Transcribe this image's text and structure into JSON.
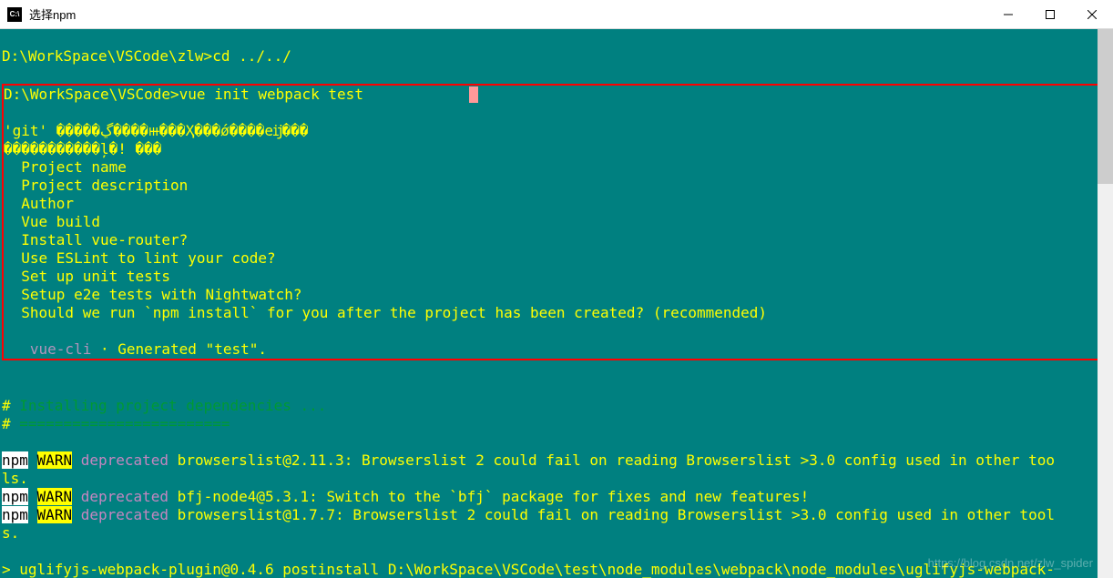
{
  "window": {
    "title": "选择npm",
    "icon_label": "C:\\"
  },
  "terminal": {
    "prompt1": "D:\\WorkSpace\\VSCode\\zlw>",
    "cmd1": "cd ../../",
    "prompt2": "D:\\WorkSpace\\VSCode>",
    "cmd2": "vue init webpack test",
    "git_line1": "'git' �����ڲ����ⲿ���Ҳ���ǿ����еĳ���",
    "git_line2": "�����������ļ�! ���",
    "prompts": [
      "Project name",
      "Project description",
      "Author",
      "Vue build",
      "Install vue-router?",
      "Use ESLint to lint your code?",
      "Set up unit tests",
      "Setup e2e tests with Nightwatch?",
      "Should we run `npm install` for you after the project has been created? (recommended)"
    ],
    "vuecli_label": "   vue-cli",
    "vuecli_dot": " · ",
    "vuecli_msg": "Generated \"test\".",
    "hash": "#",
    "install_msg": " Installing project dependencies ...",
    "divider": " ========================",
    "npm": "npm",
    "warn": "WARN",
    "deprecated": "deprecated",
    "warn1": " browserslist@2.11.3: Browserslist 2 could fail on reading Browserslist >3.0 config used in other too",
    "warn1_cont": "ls.",
    "warn2": " bfj-node4@5.3.1: Switch to the `bfj` package for fixes and new features!",
    "warn3": " browserslist@1.7.7: Browserslist 2 could fail on reading Browserslist >3.0 config used in other tool",
    "warn3_cont": "s.",
    "postinstall_arrow": "> ",
    "postinstall": "uglifyjs-webpack-plugin@0.4.6 postinstall D:\\WorkSpace\\VSCode\\test\\node_modules\\webpack\\node_modules\\uglifyjs-webpack-"
  },
  "watermark": "https://blog.csdn.net/zlw_spider"
}
